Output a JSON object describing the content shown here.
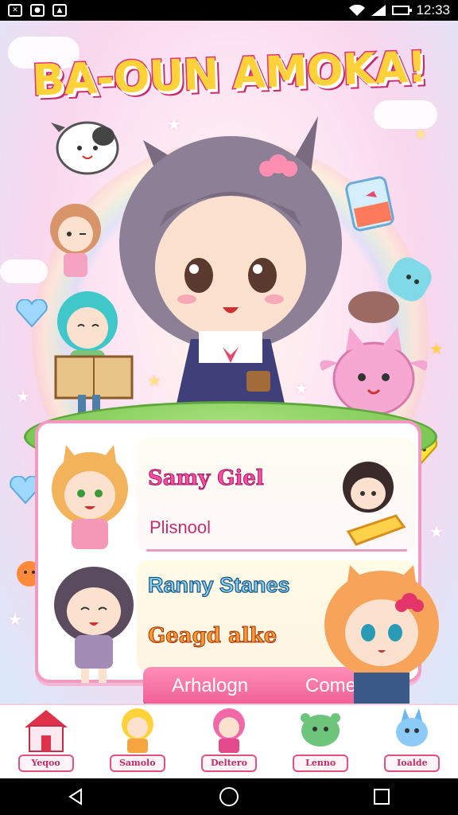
{
  "status_bar": {
    "time": "12:33"
  },
  "game": {
    "title": "BA-OUN AMOKA!"
  },
  "panel": {
    "entry1_name": "Samy Giel",
    "entry1_sub": "Plisnool",
    "entry2_name": "Ranny Stanes",
    "entry3_name": "Geagd alke",
    "button_left": "Arhalogn",
    "button_right": "Comer"
  },
  "bottom_nav": {
    "items": [
      {
        "label": "Yeqoo",
        "icon": "house-icon"
      },
      {
        "label": "Samolo",
        "icon": "blonde-character-icon"
      },
      {
        "label": "Deltero",
        "icon": "pink-character-icon"
      },
      {
        "label": "Lenno",
        "icon": "green-creature-icon"
      },
      {
        "label": "Ioalde",
        "icon": "blue-creature-icon"
      }
    ]
  },
  "colors": {
    "title_fill": "#ffd23a",
    "title_outline": "#e0317a",
    "accent_pink": "#f05f97",
    "panel_border": "#f29ac2"
  }
}
